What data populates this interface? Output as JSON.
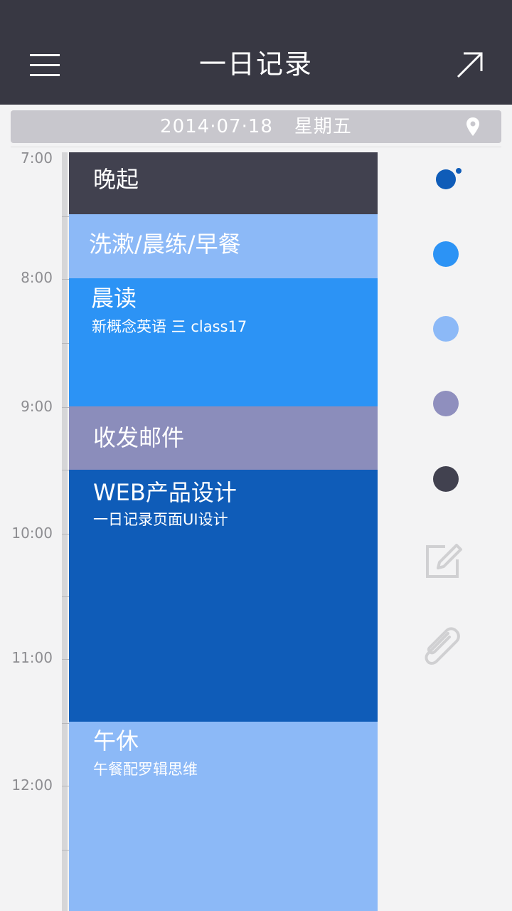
{
  "header": {
    "title": "一日记录",
    "menu_icon": "menu-icon",
    "share_icon": "arrow-up-right-icon"
  },
  "date_bar": {
    "date": "2014·07·18",
    "weekday": "星期五",
    "location_icon": "location-pin-icon"
  },
  "timeline": {
    "hours": [
      "7:00",
      "8:00",
      "9:00",
      "10:00",
      "11:00",
      "12:00"
    ]
  },
  "events": [
    {
      "title": "晚起",
      "subtitle": "",
      "color": "#41414f"
    },
    {
      "title": "洗漱/晨练/早餐",
      "subtitle": "",
      "color": "#8cb9f7"
    },
    {
      "title": "晨读",
      "subtitle": "新概念英语 三 class17",
      "color": "#2c93f5"
    },
    {
      "title": "收发邮件",
      "subtitle": "",
      "color": "#8b8dbb"
    },
    {
      "title": "WEB产品设计",
      "subtitle": "一日记录页面UI设计",
      "color": "#0f5cb8"
    },
    {
      "title": "午休",
      "subtitle": "午餐配罗辑思维",
      "color": "#8cb9f7"
    }
  ],
  "palette": {
    "colors": [
      "#0f5cb8",
      "#2c93f5",
      "#8cb9f7",
      "#8f8fbe",
      "#41414f"
    ],
    "selected_index": 0
  },
  "tools": {
    "edit_icon": "edit-icon",
    "attach_icon": "paperclip-icon"
  }
}
